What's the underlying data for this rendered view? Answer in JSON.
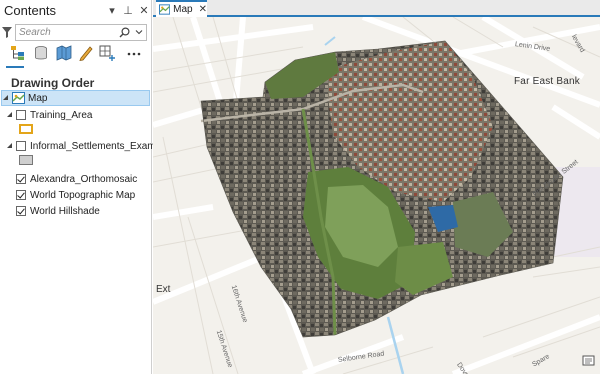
{
  "contents": {
    "title": "Contents",
    "header_controls": {
      "options": "▾",
      "pin": "⊥",
      "close": "✕"
    },
    "search": {
      "placeholder": "Search"
    },
    "section_title": "Drawing Order",
    "tree": [
      {
        "label": "Map",
        "type": "map",
        "expanded": true,
        "selected": true
      },
      {
        "label": "Training_Area",
        "type": "group",
        "checked": false,
        "expanded": true,
        "symbol_color": "#e6a51a"
      },
      {
        "label": "Informal_Settlements_Examples",
        "type": "group",
        "checked": false,
        "expanded": true,
        "symbol_color": "#c8c8c8"
      },
      {
        "label": "Alexandra_Orthomosaic",
        "type": "layer",
        "checked": true
      },
      {
        "label": "World Topographic Map",
        "type": "layer",
        "checked": true
      },
      {
        "label": "World Hillshade",
        "type": "layer",
        "checked": true
      }
    ],
    "toolbar_icons": [
      "list-by-drawing-order-icon",
      "list-by-source-icon",
      "list-by-selection-icon",
      "list-by-editing-icon",
      "list-by-snapping-icon",
      "more-options-icon"
    ]
  },
  "map_view": {
    "tab_label": "Map",
    "tab_close": "✕",
    "labels": {
      "place": "Far East Bank",
      "ext": "Ext",
      "lenin": "Lenin Drive",
      "phil": "Phil Zinzhu Street",
      "selborne": "Selborne Road",
      "avenue16": "16th Avenue",
      "avenue15": "15th Avenue",
      "boulevard": "levard",
      "spare": "Spare",
      "dove": "Dove"
    },
    "colors": {
      "accent": "#2a7ab9",
      "map_bg": "#f3f1ec",
      "road": "#ffffff",
      "water": "#a9d3ef",
      "park": "#d5ebc4"
    }
  }
}
